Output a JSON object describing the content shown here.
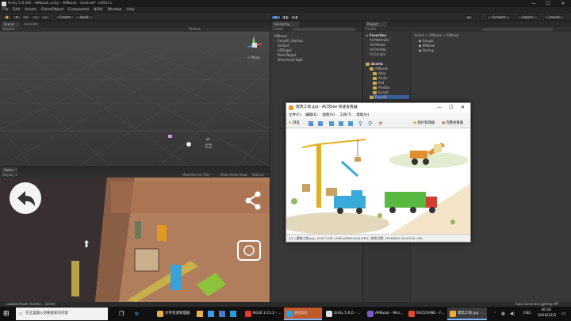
{
  "window": {
    "title": "Unity 5.6.0f3 - AMbook.unity - AMbook - Android* <DX11>",
    "minimize": "—",
    "maximize": "☐",
    "close": "✕"
  },
  "menu": [
    "File",
    "Edit",
    "Assets",
    "GameObject",
    "Component",
    "NGUI",
    "Window",
    "Help"
  ],
  "toolbar": {
    "pivot": "Center",
    "local": "Local",
    "account": "Account",
    "layers": "Layers",
    "layout": "Layout"
  },
  "scene": {
    "tabs": [
      "Scene",
      "Animator"
    ],
    "shaded": "Shaded",
    "gizmos": "Gizmos",
    "persp": "< Persp"
  },
  "game": {
    "tabs": [
      "Game"
    ],
    "display": "Display 1",
    "maximize": "Maximize on Play",
    "mute": "Mute Audio",
    "stats": "Stats",
    "gizmos": "Gizmos"
  },
  "hierarchy": {
    "tab": "Hierarchy",
    "create": "Create",
    "items": [
      "AMbook",
      "EasyAR_Startup",
      "UI Root",
      "ARTarget",
      "PlaneTarget",
      "Directional light"
    ]
  },
  "project": {
    "tab": "Project",
    "create": "Create",
    "favorites_title": "Favorites",
    "favorites": [
      "All Materials",
      "All Models",
      "All Prefabs",
      "All Scripts"
    ],
    "assets_title": "Assets",
    "assets": [
      "AMbook",
      "Atlas",
      "Audio",
      "Pad",
      "Prefabs",
      "Scripts",
      "EasyAR"
    ],
    "breadcrumb": "Assets > AMbook > AMbook",
    "files": [
      "Google",
      "AMbook",
      "Startup"
    ]
  },
  "acdsee": {
    "title": "建筑工地.jpg - ACDSee 快速查看器",
    "menu": [
      "文件(F)",
      "编辑(E)",
      "视图(V)",
      "工具(T)",
      "帮助(H)"
    ],
    "browse": "浏览",
    "manager": "照片管理器",
    "fullviewer": "完整查看器",
    "status": "1/1 | 建筑工地.jpg | 2347.5 KB | 3951x2801x24b JPEG | 修改日期: 2016/6/29 16:43:00 | 9%"
  },
  "statusbar": "Loaded Asset: Assets/... (error)",
  "statusbar_right": "Auto Generate Lighting Off",
  "taskbar": {
    "search": "在这里输入你要搜索的内容",
    "items": [
      {
        "label": "文件资源管理器",
        "color": "#e8b04a"
      },
      {
        "label": "NGUI 3.11.2 - ...",
        "color": "#e33b2e"
      },
      {
        "label": "周记QQ",
        "color": "#2aa1e5"
      },
      {
        "label": "Unity 5.6.0 - ...",
        "color": "#dddddd"
      },
      {
        "label": "AMbook - Micr...",
        "color": "#7a5cc4"
      },
      {
        "label": "RECEIVING - F...",
        "color": "#e84a2e"
      },
      {
        "label": "建筑工地.jpg - ...",
        "color": "#f2a93b"
      }
    ],
    "lang": "ENG",
    "time": "16:54",
    "date": "2016/12/3"
  },
  "colors": {
    "unity_dark": "#383838",
    "accent": "#3b78c4",
    "taskbar": "#101010"
  }
}
